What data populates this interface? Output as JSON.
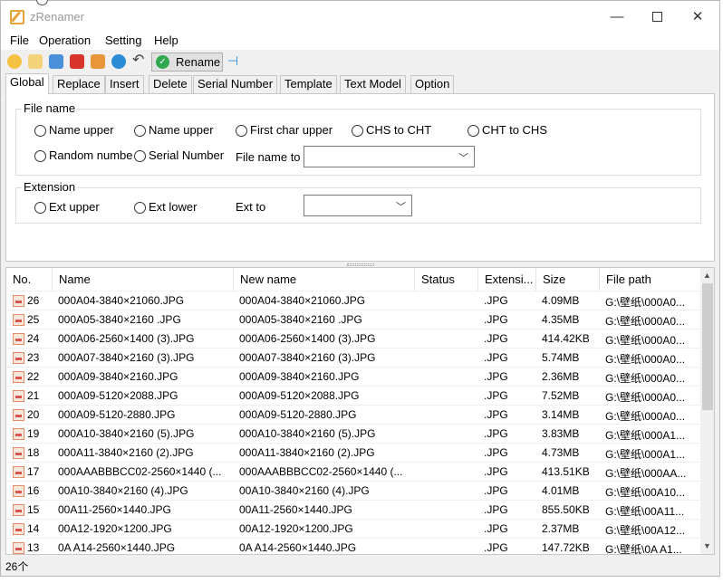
{
  "window": {
    "title": "zRenamer",
    "controls": {
      "minimize": "—",
      "close": "✕"
    }
  },
  "menu": [
    "File",
    "Operation",
    "Setting",
    "Help"
  ],
  "toolbar": {
    "rename_label": "Rename",
    "icons": [
      {
        "name": "add-file-icon",
        "color": "#f5c242"
      },
      {
        "name": "add-folder-icon",
        "color": "#f3d27a"
      },
      {
        "name": "copy-icon",
        "color": "#4a90d9"
      },
      {
        "name": "clear-icon",
        "color": "#d9342b"
      },
      {
        "name": "edit-list-icon",
        "color": "#e8963a"
      },
      {
        "name": "refresh-icon",
        "color": "#2b8cd6"
      },
      {
        "name": "undo-icon",
        "color": "#444444"
      }
    ]
  },
  "tabs": [
    "Global",
    "Replace",
    "Insert",
    "Delete",
    "Serial Number",
    "Template",
    "Text Model",
    "Option"
  ],
  "active_tab": "Global",
  "global": {
    "file_name_group": "File name",
    "file_name_options_row1": [
      "Name upper",
      "Name upper",
      "First char upper",
      "CHS to CHT",
      "CHT to CHS"
    ],
    "file_name_options_row2": [
      "Random numbe",
      "Serial Number"
    ],
    "file_name_to_label": "File name to",
    "file_name_to_value": "",
    "extension_group": "Extension",
    "extension_options": [
      "Ext upper",
      "Ext lower"
    ],
    "ext_to_label": "Ext to",
    "ext_to_value": ""
  },
  "table": {
    "columns": [
      "No.",
      "Name",
      "New name",
      "Status",
      "Extensi...",
      "Size",
      "File path"
    ],
    "rows": [
      {
        "no": "26",
        "name": "000A04-3840×21060.JPG",
        "new_name": "000A04-3840×21060.JPG",
        "status": "",
        "ext": ".JPG",
        "size": "4.09MB",
        "path": "G:\\壁纸\\000A0..."
      },
      {
        "no": "25",
        "name": "000A05-3840×2160 .JPG",
        "new_name": "000A05-3840×2160 .JPG",
        "status": "",
        "ext": ".JPG",
        "size": "4.35MB",
        "path": "G:\\壁纸\\000A0..."
      },
      {
        "no": "24",
        "name": "000A06-2560×1400 (3).JPG",
        "new_name": "000A06-2560×1400 (3).JPG",
        "status": "",
        "ext": ".JPG",
        "size": "414.42KB",
        "path": "G:\\壁纸\\000A0..."
      },
      {
        "no": "23",
        "name": "000A07-3840×2160 (3).JPG",
        "new_name": "000A07-3840×2160 (3).JPG",
        "status": "",
        "ext": ".JPG",
        "size": "5.74MB",
        "path": "G:\\壁纸\\000A0..."
      },
      {
        "no": "22",
        "name": "000A09-3840×2160.JPG",
        "new_name": "000A09-3840×2160.JPG",
        "status": "",
        "ext": ".JPG",
        "size": "2.36MB",
        "path": "G:\\壁纸\\000A0..."
      },
      {
        "no": "21",
        "name": "000A09-5120×2088.JPG",
        "new_name": "000A09-5120×2088.JPG",
        "status": "",
        "ext": ".JPG",
        "size": "7.52MB",
        "path": "G:\\壁纸\\000A0..."
      },
      {
        "no": "20",
        "name": "000A09-5120-2880.JPG",
        "new_name": "000A09-5120-2880.JPG",
        "status": "",
        "ext": ".JPG",
        "size": "3.14MB",
        "path": "G:\\壁纸\\000A0..."
      },
      {
        "no": "19",
        "name": "000A10-3840×2160 (5).JPG",
        "new_name": "000A10-3840×2160 (5).JPG",
        "status": "",
        "ext": ".JPG",
        "size": "3.83MB",
        "path": "G:\\壁纸\\000A1..."
      },
      {
        "no": "18",
        "name": "000A11-3840×2160 (2).JPG",
        "new_name": "000A11-3840×2160 (2).JPG",
        "status": "",
        "ext": ".JPG",
        "size": "4.73MB",
        "path": "G:\\壁纸\\000A1..."
      },
      {
        "no": "17",
        "name": "000AAABBBCC02-2560×1440 (...",
        "new_name": "000AAABBBCC02-2560×1440 (...",
        "status": "",
        "ext": ".JPG",
        "size": "413.51KB",
        "path": "G:\\壁纸\\000AA..."
      },
      {
        "no": "16",
        "name": "00A10-3840×2160 (4).JPG",
        "new_name": "00A10-3840×2160 (4).JPG",
        "status": "",
        "ext": ".JPG",
        "size": "4.01MB",
        "path": "G:\\壁纸\\00A10..."
      },
      {
        "no": "15",
        "name": "00A11-2560×1440.JPG",
        "new_name": "00A11-2560×1440.JPG",
        "status": "",
        "ext": ".JPG",
        "size": "855.50KB",
        "path": "G:\\壁纸\\00A11..."
      },
      {
        "no": "14",
        "name": "00A12-1920×1200.JPG",
        "new_name": "00A12-1920×1200.JPG",
        "status": "",
        "ext": ".JPG",
        "size": "2.37MB",
        "path": "G:\\壁纸\\00A12..."
      },
      {
        "no": "13",
        "name": "0A A14-2560×1440.JPG",
        "new_name": "0A A14-2560×1440.JPG",
        "status": "",
        "ext": ".JPG",
        "size": "147.72KB",
        "path": "G:\\壁纸\\0A A1..."
      }
    ]
  },
  "status": {
    "count": "26个"
  }
}
